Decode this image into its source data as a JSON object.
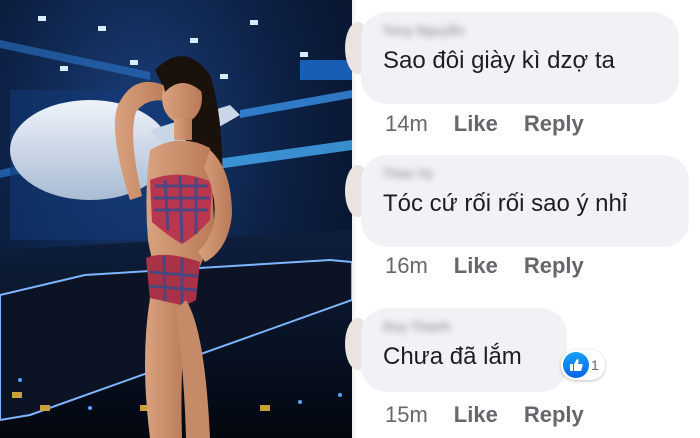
{
  "comments": [
    {
      "author": "Tony Nguyễn",
      "text": "Sao đôi giày kì dzợ ta",
      "time": "14m",
      "like_label": "Like",
      "reply_label": "Reply"
    },
    {
      "author": "Thảo Vy",
      "text": "Tóc cứ rối rối sao ý nhỉ",
      "time": "16m",
      "like_label": "Like",
      "reply_label": "Reply"
    },
    {
      "author": "Duy Thanh",
      "text": "Chưa đã lắm",
      "time": "15m",
      "like_label": "Like",
      "reply_label": "Reply",
      "reaction": {
        "icon": "thumbs-up-icon",
        "count": "1"
      }
    }
  ],
  "colors": {
    "bubble": "#f0f2f5",
    "text": "#1c1e21",
    "meta": "#65676b",
    "like_blue": "#0566e6"
  }
}
